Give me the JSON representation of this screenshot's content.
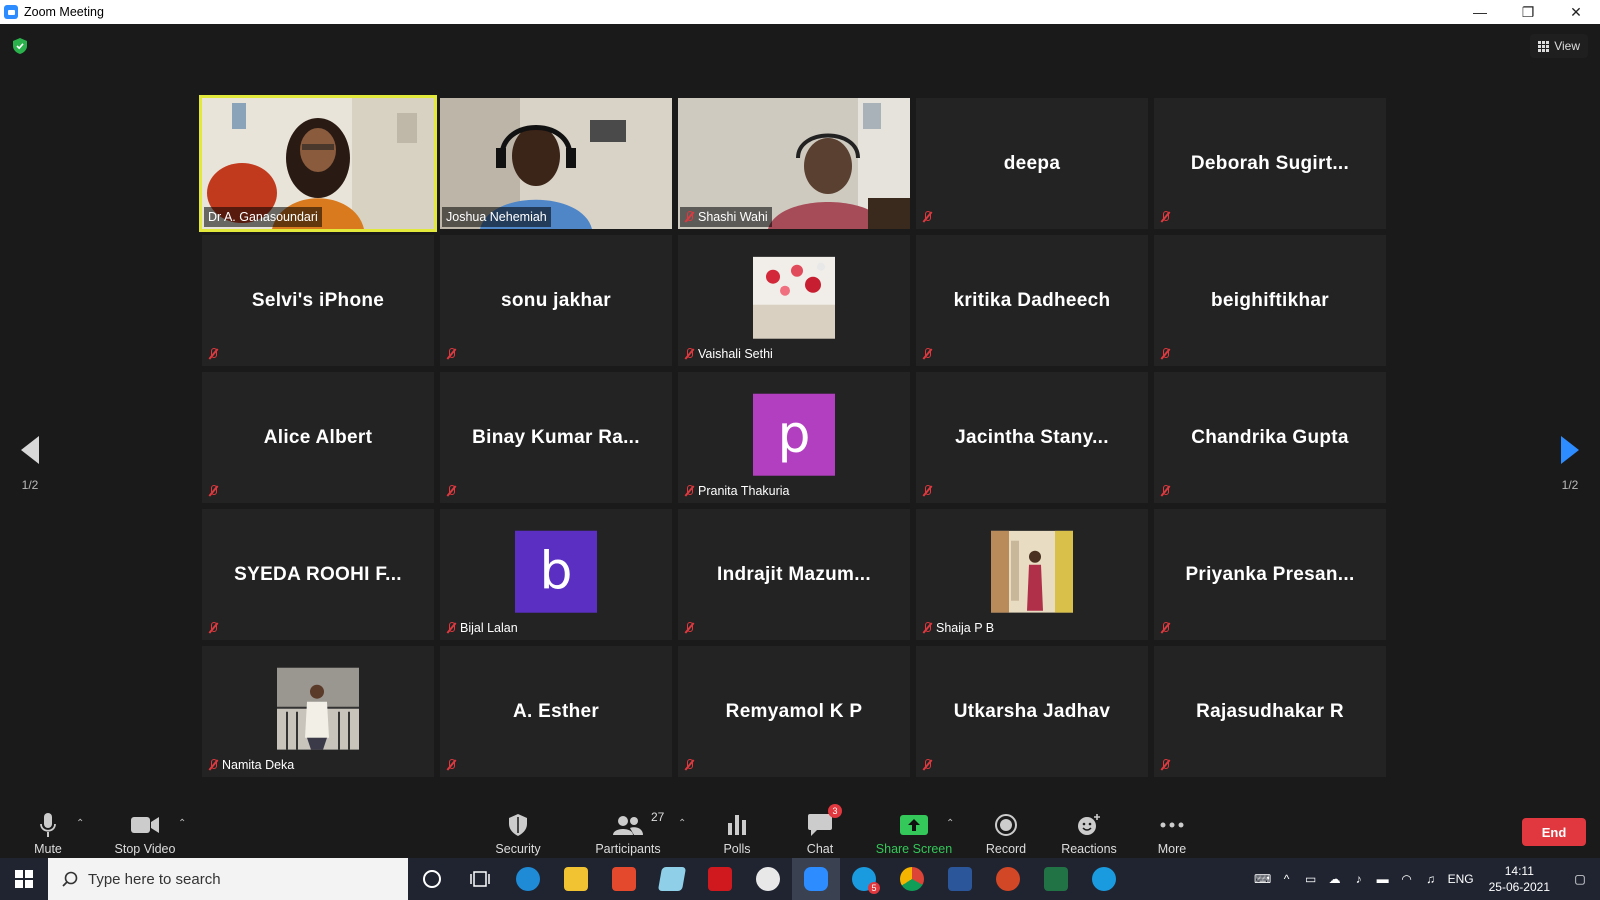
{
  "window": {
    "title": "Zoom Meeting",
    "minimize": "—",
    "restore": "❐",
    "close": "✕"
  },
  "view_button": {
    "label": "View"
  },
  "pager": {
    "left": "1/2",
    "right": "1/2"
  },
  "tiles": [
    {
      "name": "Dr A. Ganasoundari",
      "type": "video",
      "muted": false,
      "active": true
    },
    {
      "name": "Joshua Nehemiah",
      "type": "video",
      "muted": false,
      "active": false
    },
    {
      "name": "Shashi Wahi",
      "type": "video",
      "muted": true,
      "active": false
    },
    {
      "name": "deepa",
      "type": "name",
      "muted": true
    },
    {
      "name": "Deborah Sugirt...",
      "type": "name",
      "muted": true
    },
    {
      "name": "Selvi's iPhone",
      "type": "name",
      "muted": true
    },
    {
      "name": "sonu jakhar",
      "type": "name",
      "muted": true
    },
    {
      "name": "Vaishali Sethi",
      "type": "photo",
      "muted": true
    },
    {
      "name": "kritika Dadheech",
      "type": "name",
      "muted": true
    },
    {
      "name": "beighiftikhar",
      "type": "name",
      "muted": true
    },
    {
      "name": "Alice Albert",
      "type": "name",
      "muted": true
    },
    {
      "name": "Binay Kumar Ra...",
      "type": "name",
      "muted": true
    },
    {
      "name": "Pranita Thakuria",
      "type": "letter",
      "letter": "p",
      "color": "#b23fc0",
      "muted": true
    },
    {
      "name": "Jacintha Stany...",
      "type": "name",
      "muted": true
    },
    {
      "name": "Chandrika Gupta",
      "type": "name",
      "muted": true
    },
    {
      "name": "SYEDA ROOHI F...",
      "type": "name",
      "muted": true
    },
    {
      "name": "Bijal Lalan",
      "type": "letter",
      "letter": "b",
      "color": "#5b2fc2",
      "muted": true
    },
    {
      "name": "Indrajit Mazum...",
      "type": "name",
      "muted": true
    },
    {
      "name": "Shaija P B",
      "type": "photo",
      "muted": true
    },
    {
      "name": "Priyanka Presan...",
      "type": "name",
      "muted": true
    },
    {
      "name": "Namita Deka",
      "type": "photo",
      "muted": true
    },
    {
      "name": "A. Esther",
      "type": "name",
      "muted": true
    },
    {
      "name": "Remyamol K P",
      "type": "name",
      "muted": true
    },
    {
      "name": "Utkarsha Jadhav",
      "type": "name",
      "muted": true
    },
    {
      "name": "Rajasudhakar R",
      "type": "name",
      "muted": true
    }
  ],
  "toolbar": {
    "mute": "Mute",
    "stop_video": "Stop Video",
    "security": "Security",
    "participants": "Participants",
    "participants_count": "27",
    "polls": "Polls",
    "chat": "Chat",
    "chat_badge": "3",
    "share_screen": "Share Screen",
    "record": "Record",
    "reactions": "Reactions",
    "more": "More",
    "end": "End"
  },
  "taskbar": {
    "search_placeholder": "Type here to search",
    "lang": "ENG",
    "time": "14:11",
    "date": "25-06-2021",
    "skype_badge": "5"
  },
  "colors": {
    "accent": "#2d8cff",
    "end": "#e0383e",
    "share": "#34c759",
    "active_speaker": "#e2e93b"
  }
}
